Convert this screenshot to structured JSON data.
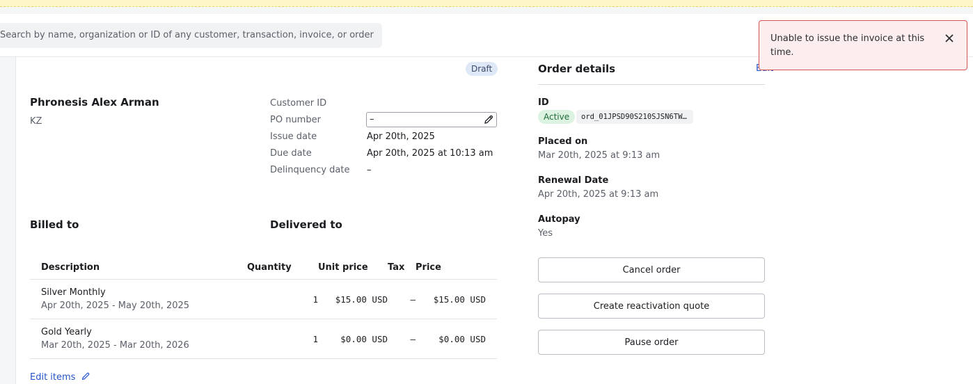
{
  "search": {
    "placeholder": "Search by name, organization or ID of any customer, transaction, invoice, or order"
  },
  "toast": {
    "message": "Unable to issue the invoice at this time.",
    "close_icon": "close-icon"
  },
  "invoice": {
    "status_badge": "Draft",
    "customer": {
      "name": "Phronesis Alex Arman",
      "country": "KZ"
    },
    "meta": {
      "customer_id_label": "Customer ID",
      "po_number_label": "PO number",
      "po_number_value": "–",
      "issue_date_label": "Issue date",
      "issue_date_value": "Apr 20th, 2025",
      "due_date_label": "Due date",
      "due_date_value": "Apr 20th, 2025 at 10:13 am",
      "delinquency_label": "Delinquency date",
      "delinquency_value": "–"
    },
    "billed_to_title": "Billed to",
    "delivered_to_title": "Delivered to",
    "table": {
      "headers": {
        "description": "Description",
        "quantity": "Quantity",
        "unit_price": "Unit price",
        "tax": "Tax",
        "price": "Price"
      },
      "rows": [
        {
          "name": "Silver Monthly",
          "period": "Apr 20th, 2025 - May 20th, 2025",
          "quantity": "1",
          "unit_price": "$15.00 USD",
          "tax": "–",
          "price": "$15.00 USD"
        },
        {
          "name": "Gold Yearly",
          "period": "Mar 20th, 2025 - Mar 20th, 2026",
          "quantity": "1",
          "unit_price": "$0.00 USD",
          "tax": "–",
          "price": "$0.00 USD"
        }
      ]
    },
    "edit_items_label": "Edit items"
  },
  "order_details": {
    "title": "Order details",
    "edit_label": "Edit",
    "id_label": "ID",
    "status_badge": "Active",
    "order_id": "ord_01JPSD90S210SJSN6TW…",
    "placed_on_label": "Placed on",
    "placed_on_value": "Mar 20th, 2025 at 9:13 am",
    "renewal_label": "Renewal Date",
    "renewal_value": "Apr 20th, 2025 at 9:13 am",
    "autopay_label": "Autopay",
    "autopay_value": "Yes",
    "buttons": {
      "cancel": "Cancel order",
      "reactivation": "Create reactivation quote",
      "pause": "Pause order"
    }
  },
  "colors": {
    "accent_link": "#2452c9",
    "toast_border": "#d9534f",
    "draft_badge": "#dfe8f7",
    "active_badge": "#dcf3e2"
  }
}
